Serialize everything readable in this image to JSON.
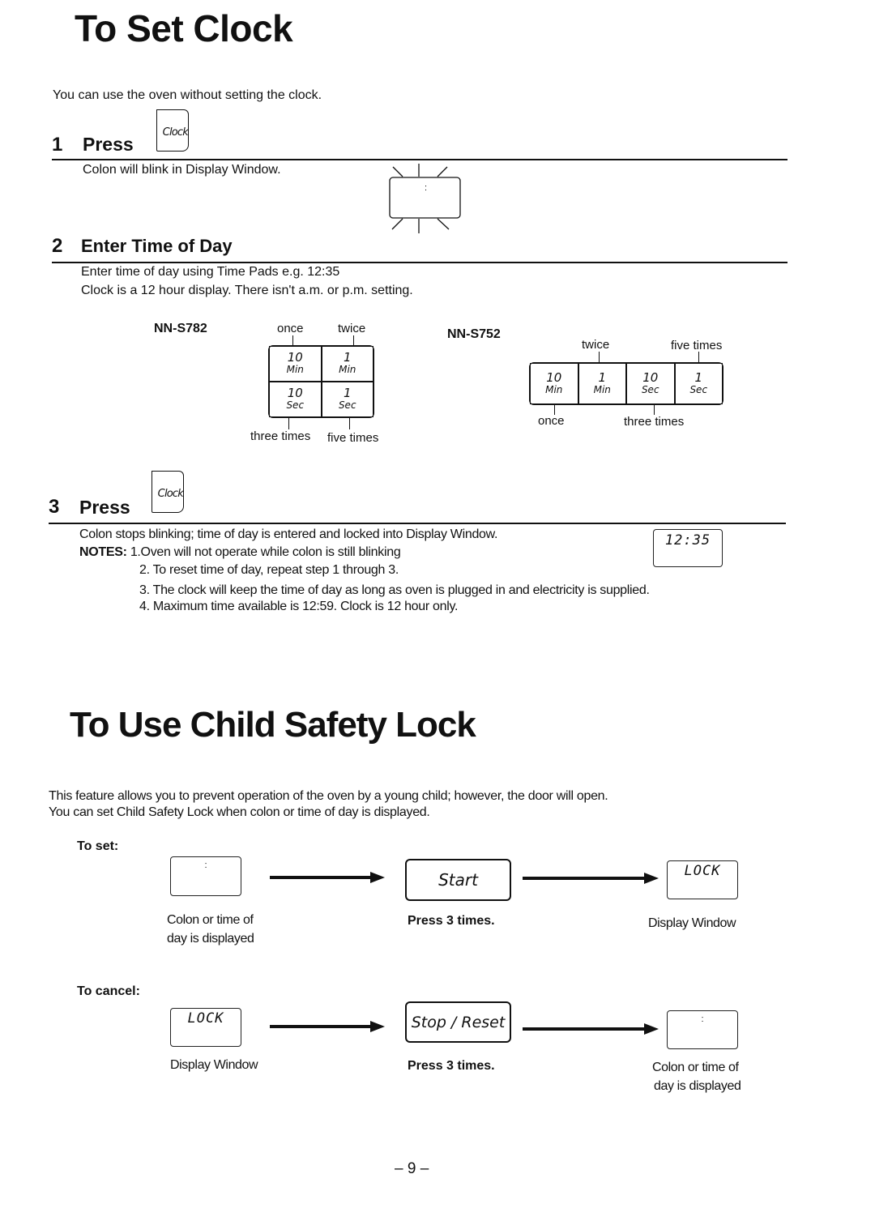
{
  "clock_section": {
    "title": "To Set Clock",
    "intro": "You can use the oven without setting the clock.",
    "step1": {
      "number": "1",
      "label": "Press",
      "key": "Clock",
      "description": "Colon will blink in Display Window.",
      "display": ":"
    },
    "step2": {
      "number": "2",
      "label": "Enter Time of Day",
      "line1": "Enter time of day using Time Pads e.g. 12:35",
      "line2": "Clock is a 12 hour display. There isn't a.m. or p.m. setting.",
      "models": [
        {
          "name": "NN-S782",
          "pads": [
            {
              "value": "10",
              "unit": "Min",
              "presses": "once"
            },
            {
              "value": "1",
              "unit": "Min",
              "presses": "twice"
            },
            {
              "value": "10",
              "unit": "Sec",
              "presses": "three times"
            },
            {
              "value": "1",
              "unit": "Sec",
              "presses": "five times"
            }
          ]
        },
        {
          "name": "NN-S752",
          "pads": [
            {
              "value": "10",
              "unit": "Min",
              "presses": "once"
            },
            {
              "value": "1",
              "unit": "Min",
              "presses": "twice"
            },
            {
              "value": "10",
              "unit": "Sec",
              "presses": "three times"
            },
            {
              "value": "1",
              "unit": "Sec",
              "presses": "five times"
            }
          ]
        }
      ]
    },
    "step3": {
      "number": "3",
      "label": "Press",
      "key": "Clock",
      "description": "Colon stops blinking; time of day is entered and locked into Display Window.",
      "display": "12:35",
      "notes_label": "NOTES:",
      "notes": [
        "1.Oven will not operate while colon is still blinking",
        "2. To reset time of day, repeat step 1 through 3.",
        "3. The clock will keep the time of day as long as oven is plugged in and electricity is supplied.",
        "4. Maximum time available is 12:59. Clock is 12 hour only."
      ]
    }
  },
  "lock_section": {
    "title": "To Use Child Safety Lock",
    "intro_line1": "This feature allows you to prevent operation of the oven by a young child; however, the door will open.",
    "intro_line2": "You can set Child Safety Lock when colon or time of day is displayed.",
    "to_set": {
      "label": "To set:",
      "from_display": ":",
      "from_caption_1": "Colon or time of",
      "from_caption_2": "day is displayed",
      "button": "Start",
      "button_caption": "Press 3 times.",
      "to_display": "LOCK",
      "to_caption": "Display Window"
    },
    "to_cancel": {
      "label": "To cancel:",
      "from_display": "LOCK",
      "from_caption": "Display Window",
      "button": "Stop / Reset",
      "button_caption": "Press 3 times.",
      "to_display": ":",
      "to_caption_1": "Colon or time of",
      "to_caption_2": "day is displayed"
    }
  },
  "footer": {
    "page_number": "– 9 –"
  }
}
